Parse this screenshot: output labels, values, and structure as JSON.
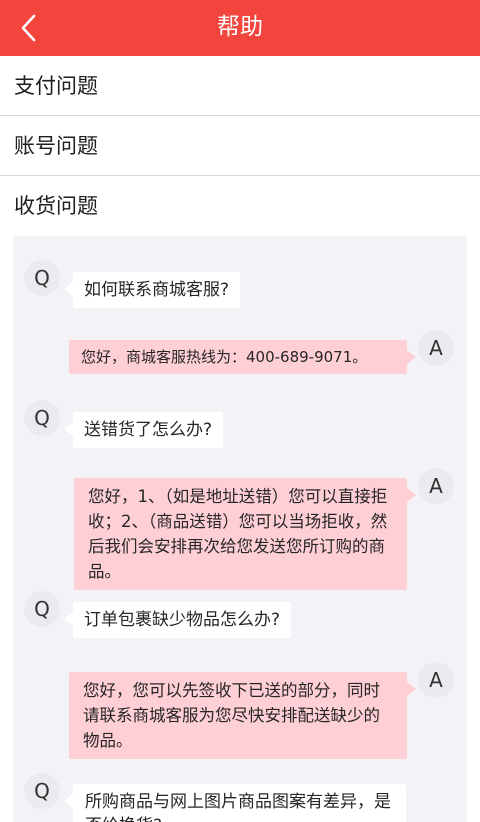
{
  "header": {
    "title": "帮助",
    "back_icon": "chevron-left-icon",
    "color": "#f2453d"
  },
  "menu": {
    "items": [
      {
        "label": "支付问题"
      },
      {
        "label": "账号问题"
      },
      {
        "label": "收货问题"
      }
    ]
  },
  "qa": {
    "question_avatar": "Q",
    "answer_avatar": "A",
    "question_bubble_color": "#ffffff",
    "answer_bubble_color": "#ffcfd6",
    "items": [
      {
        "question": "如何联系商城客服?",
        "answer": "您好，商城客服热线为：400-689-9071。"
      },
      {
        "question": "送错货了怎么办?",
        "answer": "您好，1、（如是地址送错）您可以直接拒收；2、（商品送错）您可以当场拒收，然后我们会安排再次给您发送您所订购的商品。"
      },
      {
        "question": "订单包裹缺少物品怎么办?",
        "answer": "您好，您可以先签收下已送的部分，同时请联系商城客服为您尽快安排配送缺少的物品。"
      },
      {
        "question": "所购商品与网上图片商品图案有差异，是否给换货?"
      }
    ]
  }
}
